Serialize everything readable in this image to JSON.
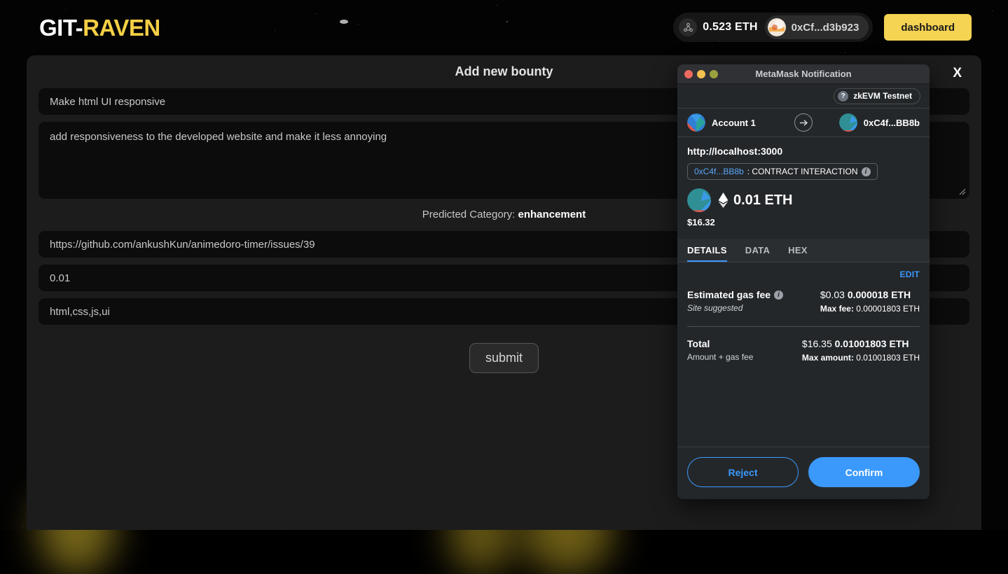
{
  "header": {
    "brand_prefix": "GIT-",
    "brand_accent": "RAVEN",
    "wallet_balance": "0.523 ETH",
    "account_address": "0xCf...d3b923",
    "dashboard_label": "dashboard",
    "network_icon": "network-nodes-icon",
    "accent_color": "#f5d353"
  },
  "modal": {
    "title": "Add new bounty",
    "close_label": "X",
    "fields": {
      "title_value": "Make html UI responsive",
      "description_value": "add responsiveness to the developed website and make it less annoying",
      "issue_url_value": "https://github.com/ankushKun/animedoro-timer/issues/39",
      "amount_value": "0.01",
      "tags_value": "html,css,js,ui"
    },
    "predicted_label": "Predicted Category:",
    "predicted_category": "enhancement",
    "submit_label": "submit"
  },
  "metamask": {
    "window_title": "MetaMask Notification",
    "traffic_lights": [
      "close-red",
      "minimize-yellow",
      "zoom-green"
    ],
    "network_name": "zkEVM Testnet",
    "network_help_glyph": "?",
    "from_account": "Account 1",
    "to_account": "0xC4f...BB8b",
    "origin": "http://localhost:3000",
    "contract_address": "0xC4f...BB8b",
    "contract_action": ": CONTRACT INTERACTION",
    "amount_eth": "0.01 ETH",
    "amount_fiat": "$16.32",
    "tabs": [
      {
        "label": "DETAILS",
        "active": true
      },
      {
        "label": "DATA",
        "active": false
      },
      {
        "label": "HEX",
        "active": false
      }
    ],
    "edit_label": "EDIT",
    "gas": {
      "label": "Estimated gas fee",
      "sub": "Site suggested",
      "fiat": "$0.03",
      "eth": "0.000018 ETH",
      "max_label": "Max fee:",
      "max_value": "0.00001803 ETH"
    },
    "total": {
      "label": "Total",
      "sub": "Amount + gas fee",
      "fiat": "$16.35",
      "eth": "0.01001803 ETH",
      "max_label": "Max amount:",
      "max_value": "0.01001803 ETH"
    },
    "reject_label": "Reject",
    "confirm_label": "Confirm",
    "accent_blue": "#3b99fc"
  }
}
